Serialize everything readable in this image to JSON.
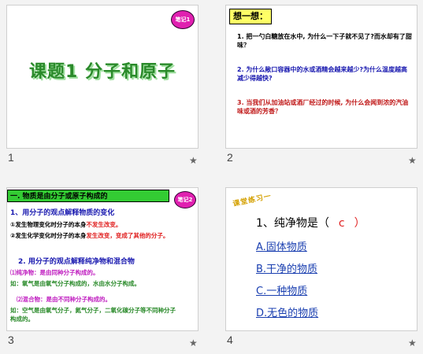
{
  "slides": [
    {
      "num": "1",
      "badge": "笔记1",
      "title": "课题1   分子和原子"
    },
    {
      "num": "2",
      "heading": "想一想：",
      "q1": "1. 把一勺白糖放在水中, 为什么一下子就不见了?而水却有了甜味？",
      "q2": "2. 为什么敞口容器中的水或酒精会越来越少?为什么温度越高减少得越快?",
      "q3": "3. 当我们从加油站或酒厂经过的时候, 为什么会闻到浓的汽油味或酒的芳香？"
    },
    {
      "num": "3",
      "badge": "笔记2",
      "header": "一. 物质是由分子或原子构成的",
      "sub1": "1、用分子的观点解释物质的变化",
      "l1a": "①发生物理变化时分子的本身",
      "l1b": "不发生改变。",
      "l2a": "②发生化学变化时分子的本身",
      "l2b": "发生改变，变成了其他的分子。",
      "sub2": "2. 用分子的观点解释纯净物和混合物",
      "p1a": "⑴纯净物：",
      "p1b": "是由同种分子构成的。",
      "ex1": "如：氧气是由氧气分子构成的，水由水分子构成。",
      "p2a": "⑵混合物：",
      "p2b": "是由不同种分子构成的。",
      "ex2": "如：空气是由氧气分子，氮气分子，二氧化碳分子等不同种分子构成的。"
    },
    {
      "num": "4",
      "deco": "课堂练习一",
      "question": "1、纯净物是（",
      "answer": "c",
      "close": "）",
      "options": [
        "A.固体物质",
        "B.干净的物质",
        "C.一种物质",
        "D.无色的物质"
      ]
    }
  ],
  "star": "★"
}
